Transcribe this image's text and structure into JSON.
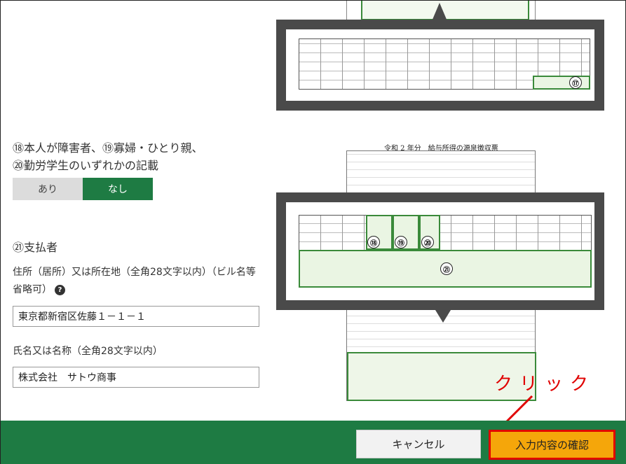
{
  "form": {
    "q18_line1": "⑱本人が障害者、⑲寡婦・ひとり親、",
    "q18_line2": "⑳勤労学生のいずれかの記載",
    "toggle": {
      "yes": "あり",
      "no": "なし",
      "selected": "なし"
    },
    "payer_heading": "㉑支払者",
    "address_label": "住所（居所）又は所在地（全角28文字以内）（ビル名等省略可）",
    "help_glyph": "?",
    "address_value": "東京都新宿区佐藤１－１－１",
    "name_label": "氏名又は名称（全角28文字以内）",
    "name_value": "株式会社　サトウ商事"
  },
  "illustration": {
    "doc_title": "令和 2 年分　給与所得の源泉徴収票",
    "mark17": "⑰",
    "mark18": "⑱",
    "mark19": "⑲",
    "mark20": "⑳",
    "mark21": "㉑"
  },
  "annotation": {
    "text": "クリック",
    "color": "#e00000"
  },
  "footer": {
    "cancel_label": "キャンセル",
    "confirm_label": "入力内容の確認",
    "bg_color": "#1e7b43",
    "confirm_color": "#f5a60a"
  }
}
